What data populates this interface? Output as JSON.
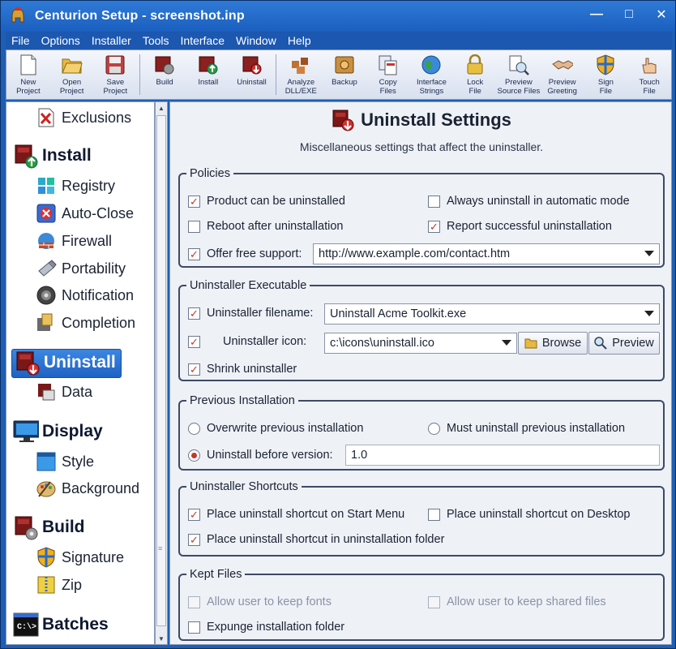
{
  "window": {
    "title": "Centurion Setup - screenshot.inp",
    "buttons": [
      "minimize",
      "maximize",
      "close"
    ]
  },
  "menu": [
    "File",
    "Options",
    "Installer",
    "Tools",
    "Interface",
    "Window",
    "Help"
  ],
  "toolbar": [
    {
      "label": "New\nProject",
      "icon": "new-document-icon"
    },
    {
      "label": "Open\nProject",
      "icon": "open-folder-icon"
    },
    {
      "label": "Save\nProject",
      "icon": "save-icon"
    },
    {
      "label": "Build",
      "icon": "build-gear-icon"
    },
    {
      "label": "Install",
      "icon": "install-icon"
    },
    {
      "label": "Uninstall",
      "icon": "uninstall-icon"
    },
    {
      "label": "Analyze\nDLL/EXE",
      "icon": "analyze-icon"
    },
    {
      "label": "Backup",
      "icon": "backup-safe-icon"
    },
    {
      "label": "Copy\nFiles",
      "icon": "copy-files-icon"
    },
    {
      "label": "Interface\nStrings",
      "icon": "globe-icon"
    },
    {
      "label": "Lock\nFile",
      "icon": "lock-icon"
    },
    {
      "label": "Preview\nSource Files",
      "icon": "preview-files-icon"
    },
    {
      "label": "Preview\nGreeting",
      "icon": "handshake-icon"
    },
    {
      "label": "Sign\nFile",
      "icon": "shield-icon"
    },
    {
      "label": "Touch\nFile",
      "icon": "hand-icon"
    }
  ],
  "sidebar": {
    "items": [
      {
        "label": "Exclusions",
        "type": "item",
        "icon": "exclusions-x-icon"
      },
      {
        "label": "Install",
        "type": "head",
        "icon": "install-box-icon"
      },
      {
        "label": "Registry",
        "type": "item",
        "icon": "registry-icon"
      },
      {
        "label": "Auto-Close",
        "type": "item",
        "icon": "auto-close-icon"
      },
      {
        "label": "Firewall",
        "type": "item",
        "icon": "firewall-icon"
      },
      {
        "label": "Portability",
        "type": "item",
        "icon": "usb-drive-icon"
      },
      {
        "label": "Notification",
        "type": "item",
        "icon": "speaker-icon"
      },
      {
        "label": "Completion",
        "type": "item",
        "icon": "completion-icon"
      },
      {
        "label": "Uninstall",
        "type": "head",
        "icon": "uninstall-box-icon",
        "selected": true
      },
      {
        "label": "Data",
        "type": "item",
        "icon": "data-icon"
      },
      {
        "label": "Display",
        "type": "head",
        "icon": "monitor-icon"
      },
      {
        "label": "Style",
        "type": "item",
        "icon": "style-icon"
      },
      {
        "label": "Background",
        "type": "item",
        "icon": "paint-palette-icon"
      },
      {
        "label": "Build",
        "type": "head",
        "icon": "build-box-icon"
      },
      {
        "label": "Signature",
        "type": "item",
        "icon": "signature-shield-icon"
      },
      {
        "label": "Zip",
        "type": "item",
        "icon": "zip-icon"
      },
      {
        "label": "Batches",
        "type": "head",
        "icon": "console-icon"
      }
    ]
  },
  "page": {
    "title": "Uninstall Settings",
    "subtitle": "Miscellaneous settings that affect the uninstaller."
  },
  "policies": {
    "legend": "Policies",
    "product_uninstallable": {
      "label": "Product can be uninstalled",
      "checked": true
    },
    "always_auto": {
      "label": "Always uninstall in automatic mode",
      "checked": false
    },
    "reboot_after": {
      "label": "Reboot after uninstallation",
      "checked": false
    },
    "report_success": {
      "label": "Report successful uninstallation",
      "checked": true
    },
    "free_support": {
      "label": "Offer free support:",
      "checked": true
    },
    "support_url": "http://www.example.com/contact.htm"
  },
  "executable": {
    "legend": "Uninstaller Executable",
    "filename_label": "Uninstaller filename:",
    "filename_value": "Uninstall Acme Toolkit.exe",
    "icon_label": "Uninstaller icon:",
    "icon_value": "c:\\icons\\uninstall.ico",
    "browse": "Browse",
    "preview": "Preview",
    "shrink": {
      "label": "Shrink uninstaller",
      "checked": true
    }
  },
  "previous": {
    "legend": "Previous Installation",
    "overwrite": {
      "label": "Overwrite previous installation",
      "selected": false
    },
    "must_uninstall": {
      "label": "Must uninstall previous installation",
      "selected": false
    },
    "before_version": {
      "label": "Uninstall before version:",
      "selected": true
    },
    "version_value": "1.0"
  },
  "shortcuts": {
    "legend": "Uninstaller Shortcuts",
    "start_menu": {
      "label": "Place uninstall shortcut on Start Menu",
      "checked": true
    },
    "desktop": {
      "label": "Place uninstall shortcut on Desktop",
      "checked": false
    },
    "folder": {
      "label": "Place uninstall shortcut in uninstallation folder",
      "checked": true
    }
  },
  "kept": {
    "legend": "Kept Files",
    "keep_fonts": {
      "label": "Allow user to keep fonts",
      "checked": false,
      "disabled": true
    },
    "keep_shared": {
      "label": "Allow user to keep shared files",
      "checked": false,
      "disabled": true
    },
    "expunge": {
      "label": "Expunge installation folder",
      "checked": false
    }
  },
  "colors": {
    "titlebar": "#1b5fbf",
    "check": "#c0392b",
    "selected": "#1f62c4"
  }
}
